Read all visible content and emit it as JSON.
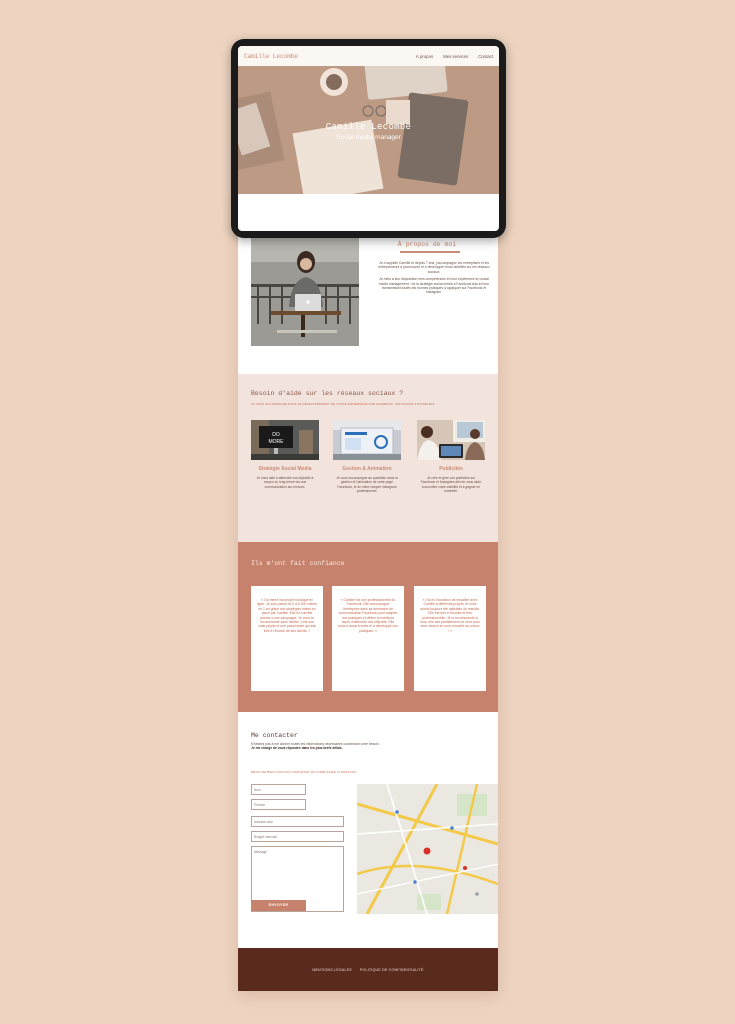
{
  "site": {
    "brand": "Camille Lecombe",
    "nav": [
      "À propos",
      "Mes services",
      "Contact"
    ],
    "hero": {
      "title": "Camille Lecombe",
      "subtitle": "Social media manager"
    }
  },
  "about": {
    "title": "À propos de moi",
    "paragraphs": [
      "Je m'appelle Camille et depuis 7 ans, j'accompagne les entreprises et les entrepreneurs à promouvoir et à développer leurs activités sur les réseaux sociaux.",
      "Je mets à leur disposition mes compétences et mon expérience en social media management : de la stratégie social media à Facebook Ads en leur transmettant toutes les bonnes pratiques à appliquer sur Facebook et Instagram."
    ]
  },
  "services": {
    "title": "Besoin d'aide sur les réseaux sociaux ?",
    "subtitle": "JE VOUS ACCOMPAGNE DANS LE DÉVELOPPEMENT DE VOTRE ENTREPRISE SUR FACEBOOK, INSTAGRAM & PINTEREST.",
    "items": [
      {
        "name": "Stratégie Social Media",
        "desc": "Je vous aide à atteindre vos objectifs à moyen ou long terme via une communication sur-mesure."
      },
      {
        "name": "Gestion & Animation",
        "desc": "Je vous accompagne au quotidien dans la gestion et l'animation de votre page Facebook, et de votre compte Instagram professionnel."
      },
      {
        "name": "Publicités",
        "desc": "Je crée et gère vos publicités sur Facebook et Instagram afin de vous aider à accroître votre visibilité et à gagner en notoriété."
      }
    ]
  },
  "testimonials": {
    "title": "Ils m'ont fait confiance",
    "items": [
      "« J'ai mené ma propre boutique en ligne. Je suis passé de 0 à 5 000 clients en 1 an grâce aux stratégies mises en place par Camille. Elle ne s'arrête jamais à une campagne. Je vous la recommande sans hésiter, c'est une vraie pépite et une passionnée qui sait être à l'écoute de ses clients. »",
      "« Camille est une professionnelle du Facebook. Elle accompagne l'entreprise dans sa démarche de communication Facebook pour adapter nos pratiques et définir la meilleure façon d'atteindre nos objectifs. Elle nous a aussi formés et a développé nos pratiques. »",
      "« J'ai eu l'occasion de travailler avec Camille à différents projets, et nous avons toujours été satisfaits du résultat. Elle est très à l'écoute et très professionnelle. Je la recommande à tous, elle sait parfaitement ce dont vous avez besoin et vous conseille au mieux ! »"
    ]
  },
  "contact": {
    "title": "Me contacter",
    "intro": "N'hésitez pas à me donner toutes les informations nécessaires concernant votre besoin.",
    "intro_bold": "Je me charge de vous répondre dans les plus brefs délais.",
    "note": "MERCI DE BIEN VOULOIR COMPLÉTER LE FORMULAIRE CI-DESSOUS :",
    "fields": {
      "nom": "Nom",
      "prenom": "Prénom",
      "email": "Adresse mail",
      "budget": "Budget mensuel",
      "message": "Message"
    },
    "send": "ENVOYER"
  },
  "footer": {
    "legal": "MENTIONS LÉGALES",
    "privacy": "POLITIQUE DE CONFIDENTIALITÉ"
  }
}
